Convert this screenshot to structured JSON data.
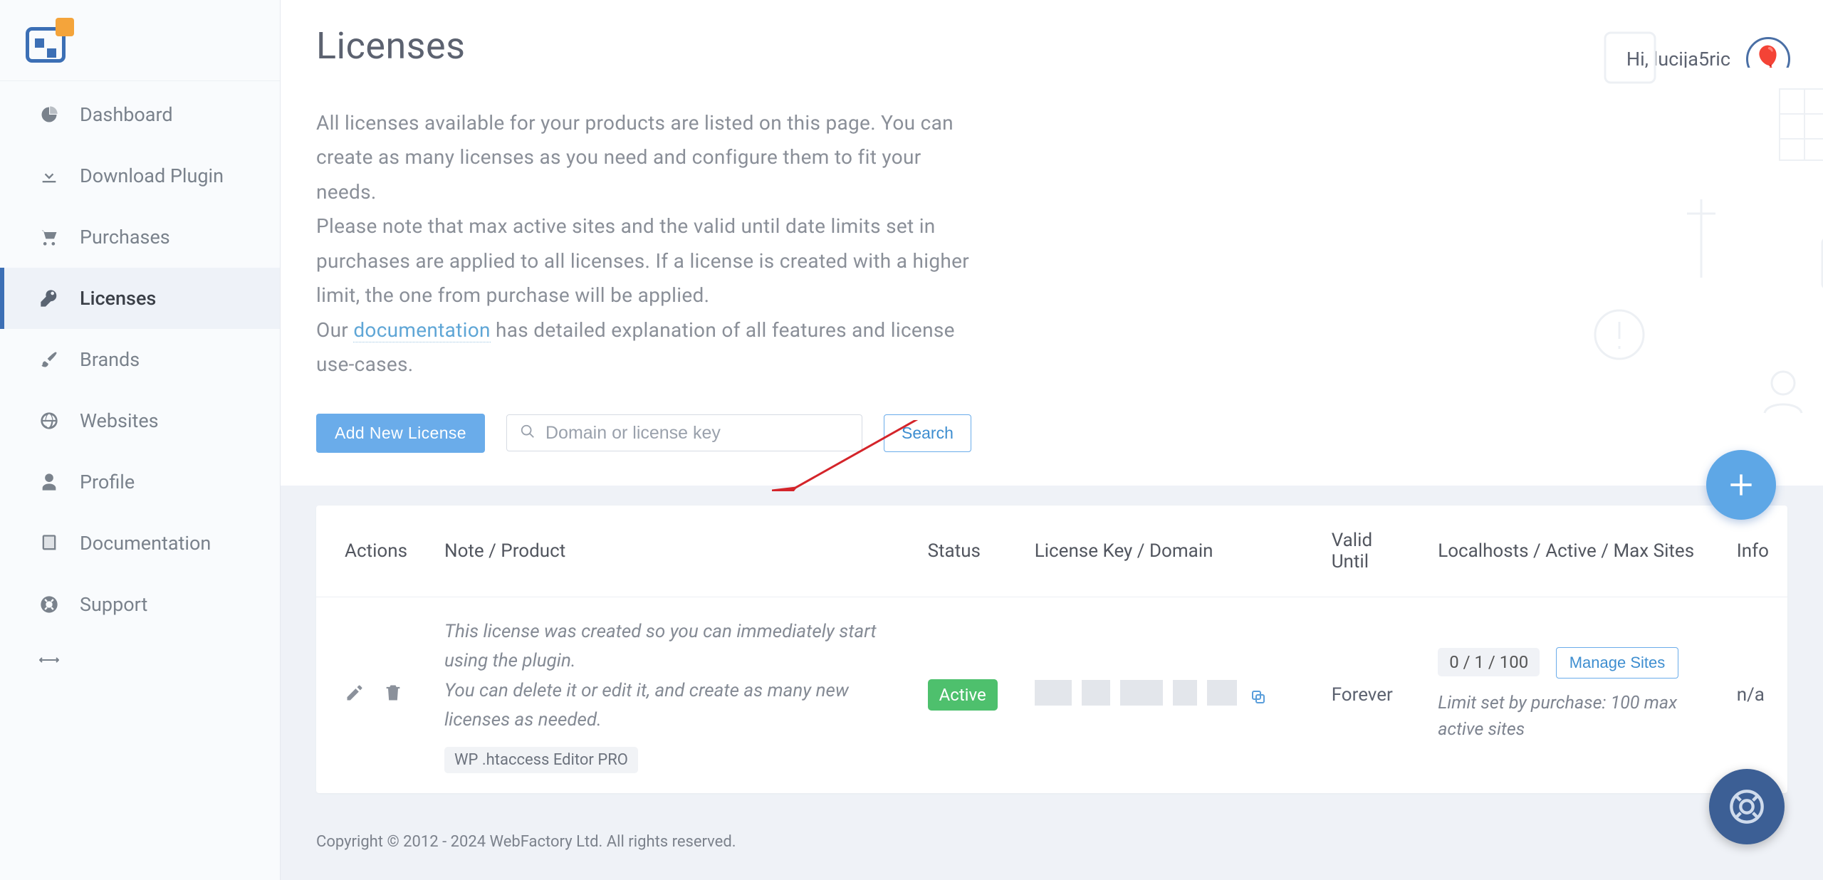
{
  "page_title": "Licenses",
  "greeting": "Hi, lucija5ric",
  "sidebar": {
    "items": [
      {
        "label": "Dashboard"
      },
      {
        "label": "Download Plugin"
      },
      {
        "label": "Purchases"
      },
      {
        "label": "Licenses"
      },
      {
        "label": "Brands"
      },
      {
        "label": "Websites"
      },
      {
        "label": "Profile"
      },
      {
        "label": "Documentation"
      },
      {
        "label": "Support"
      }
    ]
  },
  "description": {
    "p1": "All licenses available for your products are listed on this page. You can create as many licenses as you need and configure them to fit your needs.",
    "p2": "Please note that max active sites and the valid until date limits set in purchases are applied to all licenses. If a license is created with a higher limit, the one from purchase will be applied.",
    "p3a": "Our ",
    "p3_link": "documentation",
    "p3b": " has detailed explanation of all features and license use-cases."
  },
  "buttons": {
    "add_new": "Add New License",
    "search": "Search",
    "manage_sites": "Manage Sites"
  },
  "search_placeholder": "Domain or license key",
  "table": {
    "headers": {
      "actions": "Actions",
      "note": "Note / Product",
      "status": "Status",
      "license": "License Key / Domain",
      "valid": "Valid Until",
      "sites": "Localhosts / Active / Max Sites",
      "info": "Info"
    },
    "rows": [
      {
        "note1": "This license was created so you can immediately start using the plugin.",
        "note2": "You can delete it or edit it, and create as many new licenses as needed.",
        "product": "WP .htaccess Editor PRO",
        "status": "Active",
        "valid_until": "Forever",
        "counts": "0 / 1 / 100",
        "limit_note": "Limit set by purchase: 100 max active sites",
        "info": "n/a"
      }
    ]
  },
  "footer": "Copyright © 2012 - 2024 WebFactory Ltd. All rights reserved."
}
